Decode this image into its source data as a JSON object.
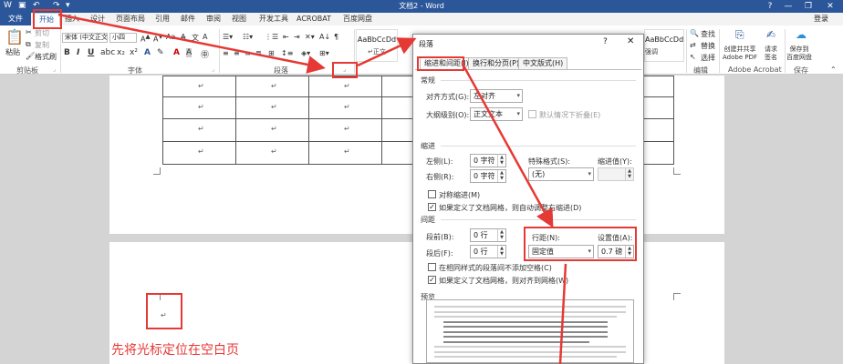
{
  "window": {
    "title": "文档2 - Word",
    "help": "?",
    "login": "登录"
  },
  "tabs": [
    "文件",
    "开始",
    "插入",
    "设计",
    "页面布局",
    "引用",
    "邮件",
    "审阅",
    "视图",
    "开发工具",
    "ACROBAT",
    "百度网盘"
  ],
  "ribbon": {
    "clipboard": {
      "paste": "粘贴",
      "cut": "剪切",
      "copy": "复制",
      "format_painter": "格式刷",
      "label": "剪贴板"
    },
    "font": {
      "font_name": "宋体 (中文正文",
      "font_size": "小四",
      "label": "字体"
    },
    "paragraph": {
      "label": "段落"
    },
    "styles": {
      "items": [
        {
          "preview": "AaBbCcDd",
          "name": "↵正文"
        },
        {
          "preview": "AaBbCcDd",
          "name": "强调"
        }
      ]
    },
    "editing": {
      "find": "查找",
      "replace": "替换",
      "select": "选择",
      "label": "编辑"
    },
    "acrobat": {
      "create": "创建并共享\nAdobe PDF",
      "request": "请求\n签名",
      "label": "Adobe Acrobat"
    },
    "save": {
      "save_to": "保存到\n百度网盘",
      "label": "保存"
    }
  },
  "document": {
    "cell_mark": "↵",
    "instruction": "先将光标定位在空白页"
  },
  "dialog": {
    "title": "段落",
    "close": "✕",
    "tabs": [
      "缩进和间距(I)",
      "换行和分页(P)",
      "中文版式(H)"
    ],
    "general": {
      "title": "常规",
      "alignment_label": "对齐方式(G):",
      "alignment_value": "左对齐",
      "outline_label": "大纲级别(O):",
      "outline_value": "正文文本",
      "collapsed_label": "默认情况下折叠(E)"
    },
    "indent": {
      "title": "缩进",
      "left_label": "左侧(L):",
      "left_value": "0 字符",
      "right_label": "右侧(R):",
      "right_value": "0 字符",
      "special_label": "特殊格式(S):",
      "special_value": "(无)",
      "by_label": "缩进值(Y):",
      "by_value": "",
      "mirror_label": "对称缩进(M)",
      "auto_adjust_label": "如果定义了文档网格，则自动调整右缩进(D)"
    },
    "spacing": {
      "title": "间距",
      "before_label": "段前(B):",
      "before_value": "0 行",
      "after_label": "段后(F):",
      "after_value": "0 行",
      "line_label": "行距(N):",
      "line_value": "固定值",
      "at_label": "设置值(A):",
      "at_value": "0.7 磅",
      "no_space_label": "在相同样式的段落间不添加空格(C)",
      "snap_label": "如果定义了文档网格，则对齐到网格(W)"
    },
    "preview": {
      "title": "预览"
    }
  },
  "colors": {
    "accent": "#2b579a",
    "annotation": "#e53935"
  }
}
